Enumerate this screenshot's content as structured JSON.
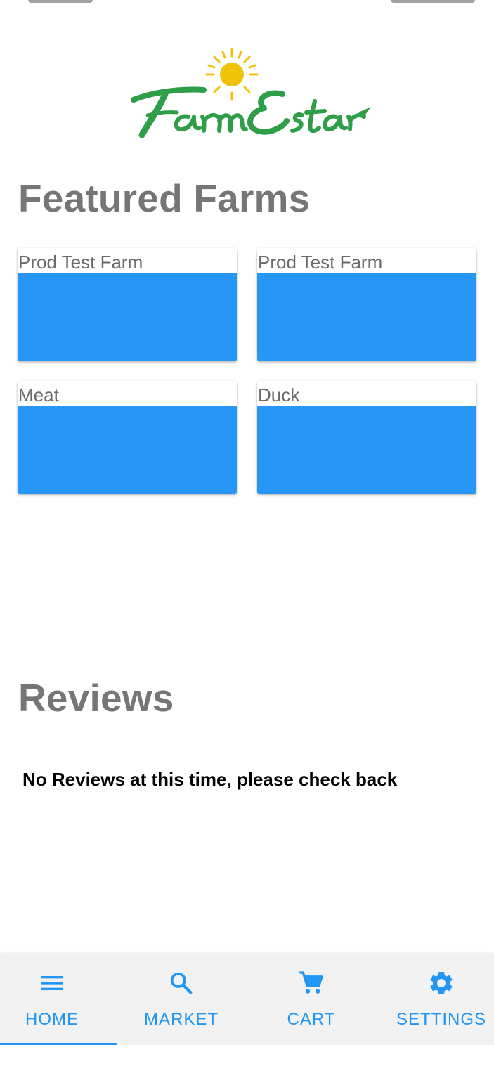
{
  "brand": {
    "logo_text": "Farm Estar",
    "colors": {
      "green": "#2e9e48",
      "sun": "#f0c20a"
    }
  },
  "featured": {
    "title": "Featured Farms",
    "farms": [
      {
        "name": "Prod Test Farm"
      },
      {
        "name": "Prod Test Farm"
      },
      {
        "name": "Meat"
      },
      {
        "name": "Duck"
      }
    ]
  },
  "reviews": {
    "title": "Reviews",
    "empty_message": "No Reviews at this time, please check back"
  },
  "nav": {
    "items": [
      {
        "label": "HOME",
        "icon": "menu-icon",
        "active": true
      },
      {
        "label": "MARKET",
        "icon": "search-icon",
        "active": false
      },
      {
        "label": "CART",
        "icon": "cart-icon",
        "active": false
      },
      {
        "label": "SETTINGS",
        "icon": "gear-icon",
        "active": false
      }
    ]
  },
  "colors": {
    "accent": "#2196f3",
    "card_image": "#2896f5",
    "title_gray": "#767676",
    "nav_background": "#f2f2f2"
  }
}
